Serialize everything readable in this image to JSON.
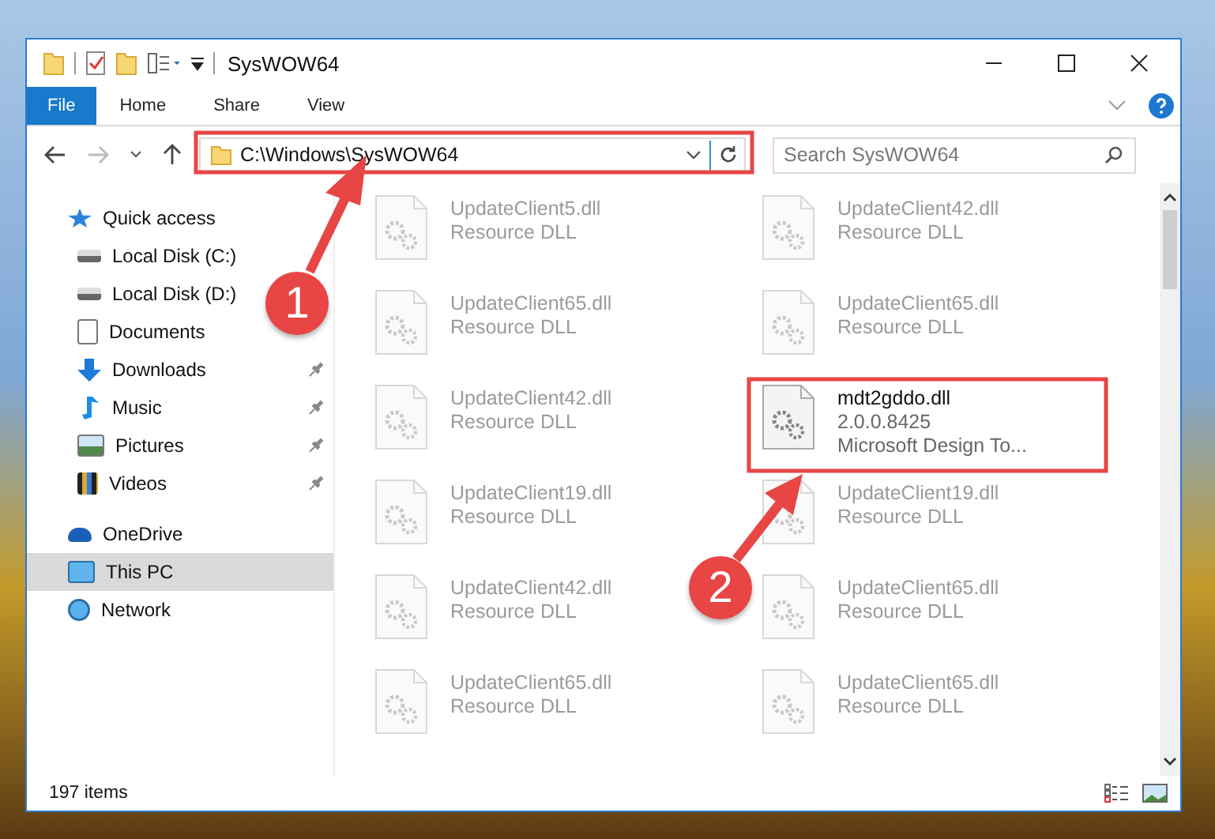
{
  "window": {
    "title": "SysWOW64"
  },
  "ribbon": {
    "tabs": [
      {
        "label": "File",
        "kind": "menu",
        "selected": false
      },
      {
        "label": "Home",
        "kind": "tab",
        "selected": false
      },
      {
        "label": "Share",
        "kind": "tab",
        "selected": false
      },
      {
        "label": "View",
        "kind": "tab",
        "selected": false
      }
    ]
  },
  "address": {
    "path": "C:\\Windows\\SysWOW64"
  },
  "search": {
    "placeholder": "Search SysWOW64"
  },
  "nav": [
    {
      "label": "Quick access",
      "selected": false,
      "children": [
        {
          "label": "Local Disk (C:)",
          "pinned": false,
          "selected": false
        },
        {
          "label": "Local Disk (D:)",
          "pinned": false,
          "selected": false
        },
        {
          "label": "Documents",
          "pinned": false,
          "selected": false
        },
        {
          "label": "Downloads",
          "pinned": true,
          "selected": false
        },
        {
          "label": "Music",
          "pinned": true,
          "selected": false
        },
        {
          "label": "Pictures",
          "pinned": true,
          "selected": false
        },
        {
          "label": "Videos",
          "pinned": true,
          "selected": false
        }
      ]
    },
    {
      "label": "OneDrive",
      "selected": false
    },
    {
      "label": "This PC",
      "selected": true
    },
    {
      "label": "Network",
      "selected": false
    }
  ],
  "files": [
    {
      "name": "UpdateClient5.dll",
      "details": [
        "Resource DLL"
      ],
      "dimmed": true
    },
    {
      "name": "UpdateClient42.dll",
      "details": [
        "Resource DLL"
      ],
      "dimmed": true
    },
    {
      "name": "UpdateClient65.dll",
      "details": [
        "Resource DLL"
      ],
      "dimmed": true
    },
    {
      "name": "UpdateClient65.dll",
      "details": [
        "Resource DLL"
      ],
      "dimmed": true
    },
    {
      "name": "UpdateClient42.dll",
      "details": [
        "Resource DLL"
      ],
      "dimmed": true
    },
    {
      "name": "mdt2gddo.dll",
      "details": [
        "2.0.0.8425",
        "Microsoft Design To..."
      ],
      "dimmed": false
    },
    {
      "name": "UpdateClient19.dll",
      "details": [
        "Resource DLL"
      ],
      "dimmed": true
    },
    {
      "name": "UpdateClient19.dll",
      "details": [
        "Resource DLL"
      ],
      "dimmed": true
    },
    {
      "name": "UpdateClient42.dll",
      "details": [
        "Resource DLL"
      ],
      "dimmed": true
    },
    {
      "name": "UpdateClient65.dll",
      "details": [
        "Resource DLL"
      ],
      "dimmed": true
    },
    {
      "name": "UpdateClient65.dll",
      "details": [
        "Resource DLL"
      ],
      "dimmed": true
    },
    {
      "name": "UpdateClient65.dll",
      "details": [
        "Resource DLL"
      ],
      "dimmed": true
    }
  ],
  "status_bar": {
    "count": "197 items"
  },
  "callouts": [
    {
      "number": "1"
    },
    {
      "number": "2"
    }
  ]
}
